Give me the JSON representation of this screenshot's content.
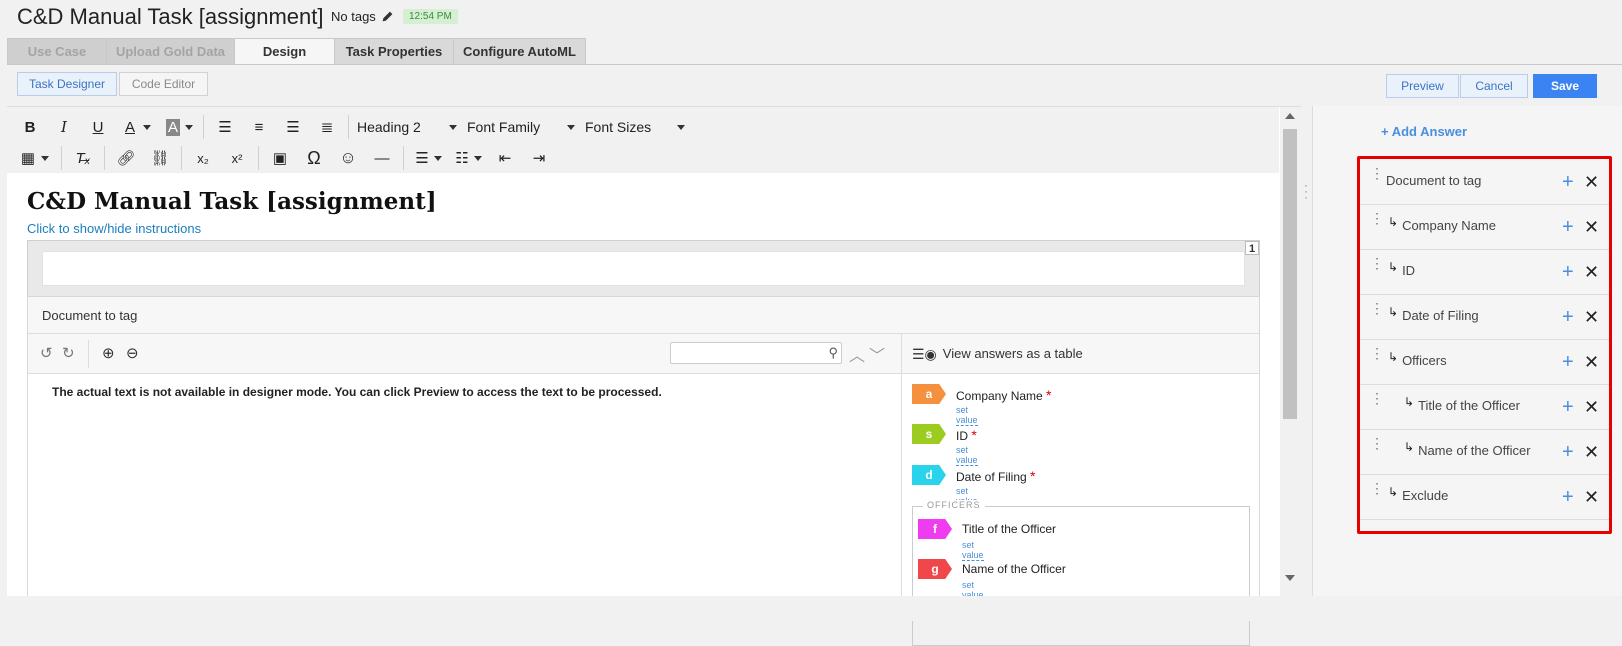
{
  "header": {
    "title": "C&D Manual Task [assignment]",
    "tags_label": "No tags",
    "time": "12:54 PM"
  },
  "tabs": [
    {
      "label": "Use Case",
      "state": "disabled"
    },
    {
      "label": "Upload Gold Data",
      "state": "disabled"
    },
    {
      "label": "Design",
      "state": "active"
    },
    {
      "label": "Task Properties",
      "state": "normal"
    },
    {
      "label": "Configure AutoML",
      "state": "normal"
    }
  ],
  "mode_buttons": {
    "task_designer": "Task Designer",
    "code_editor": "Code Editor"
  },
  "actions": {
    "preview": "Preview",
    "cancel": "Cancel",
    "save": "Save"
  },
  "rte": {
    "heading_select": "Heading 2",
    "font_family_select": "Font Family",
    "font_sizes_select": "Font Sizes"
  },
  "editor": {
    "doc_title": "C&D Manual Task [assignment]",
    "toggle_instructions": "Click to show/hide instructions",
    "page_number": "1",
    "document_label": "Document to tag",
    "designer_note": "The actual text is not available in designer mode. You can click Preview to access the text to be processed.",
    "view_table_label": "View answers as a table",
    "set_value": "set value",
    "officers_group": "OFFICERS",
    "answer_tags": [
      {
        "key": "a",
        "label": "Company Name",
        "color": "#f5913e",
        "required": "*"
      },
      {
        "key": "s",
        "label": "ID",
        "color": "#9ccc1f",
        "required": "*"
      },
      {
        "key": "d",
        "label": "Date of Filing",
        "color": "#29d3ec",
        "required": "*"
      }
    ],
    "officer_tags": [
      {
        "key": "f",
        "label": "Title of the Officer",
        "color": "#f03cf0"
      },
      {
        "key": "g",
        "label": "Name of the Officer",
        "color": "#f0484a"
      }
    ]
  },
  "right_panel": {
    "add_answer": "+ Add Answer",
    "items": [
      {
        "label": "Document to tag",
        "level": 0
      },
      {
        "label": "Company Name",
        "level": 1
      },
      {
        "label": "ID",
        "level": 1
      },
      {
        "label": "Date of Filing",
        "level": 1
      },
      {
        "label": "Officers",
        "level": 1
      },
      {
        "label": "Title of the Officer",
        "level": 2
      },
      {
        "label": "Name of the Officer",
        "level": 2
      },
      {
        "label": "Exclude",
        "level": 1
      }
    ]
  },
  "colors": {
    "accent": "#3b82f2",
    "highlight_border": "#e60000",
    "link": "#1a7fbf"
  }
}
